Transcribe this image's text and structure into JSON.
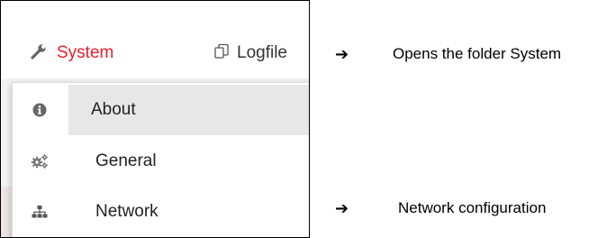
{
  "colors": {
    "accent": "#e8202a",
    "icon_gray": "#666666",
    "highlight": "#e7e7e7"
  },
  "navbar": {
    "system": {
      "label": "System",
      "icon": "wrench-icon"
    },
    "logfile": {
      "label": "Logfile",
      "icon": "copy-icon"
    }
  },
  "dropdown": {
    "items": [
      {
        "label": "About",
        "icon": "info-icon",
        "selected": true
      },
      {
        "label": "General",
        "icon": "cogs-icon"
      },
      {
        "label": "Network",
        "icon": "sitemap-icon"
      }
    ]
  },
  "annotations": {
    "system_arrow": "➔",
    "system_text": "Opens the folder System",
    "network_arrow": "➔",
    "network_text": "Network configuration"
  }
}
